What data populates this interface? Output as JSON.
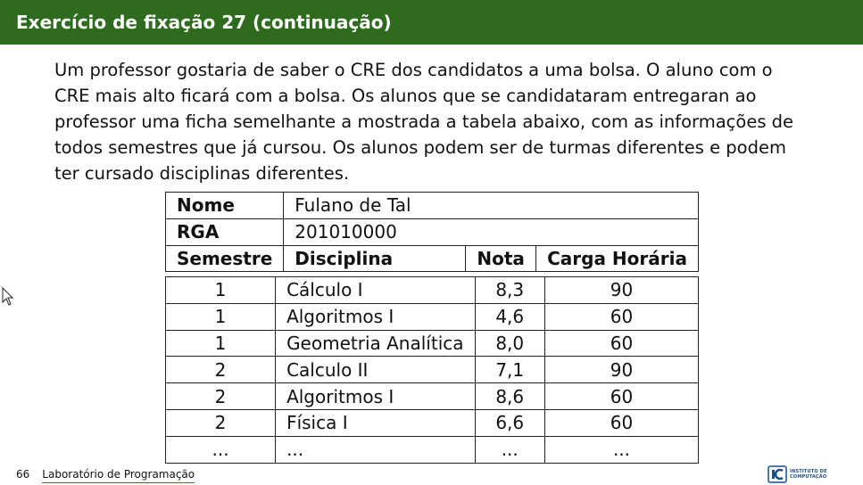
{
  "slide": {
    "title": "Exercício de fixação 27 (continuação)",
    "paragraph": "Um professor gostaria de saber o CRE dos candidatos a uma bolsa. O aluno com o CRE mais alto ficará com a bolsa. Os alunos que se candidataram entregaran ao professor uma ficha semelhante a mostrada a tabela abaixo, com as informações de todos semestres que já cursou. Os alunos podem ser de turmas diferentes e podem ter cursado disciplinas diferentes."
  },
  "ficha": {
    "nome_label": "Nome",
    "nome_value": "Fulano de Tal",
    "rga_label": "RGA",
    "rga_value": "201010000",
    "headers": [
      "Semestre",
      "Disciplina",
      "Nota",
      "Carga Horária"
    ],
    "rows": [
      [
        "1",
        "Cálculo I",
        "8,3",
        "90"
      ],
      [
        "1",
        "Algoritmos I",
        "4,6",
        "60"
      ],
      [
        "1",
        "Geometria Analítica",
        "8,0",
        "60"
      ],
      [
        "2",
        "Calculo II",
        "7,1",
        "90"
      ],
      [
        "2",
        "Algoritmos I",
        "8,6",
        "60"
      ],
      [
        "2",
        "Física I",
        "6,6",
        "60"
      ],
      [
        "...",
        "...",
        "...",
        "..."
      ]
    ]
  },
  "footer": {
    "page_number": "66",
    "course": "Laboratório de Programação"
  },
  "logo": {
    "line1": "INSTITUTO DE",
    "line2": "COMPUTAÇÃO"
  },
  "colors": {
    "title_bar": "#2f6b1e",
    "footer_underline": "#c0392b"
  }
}
